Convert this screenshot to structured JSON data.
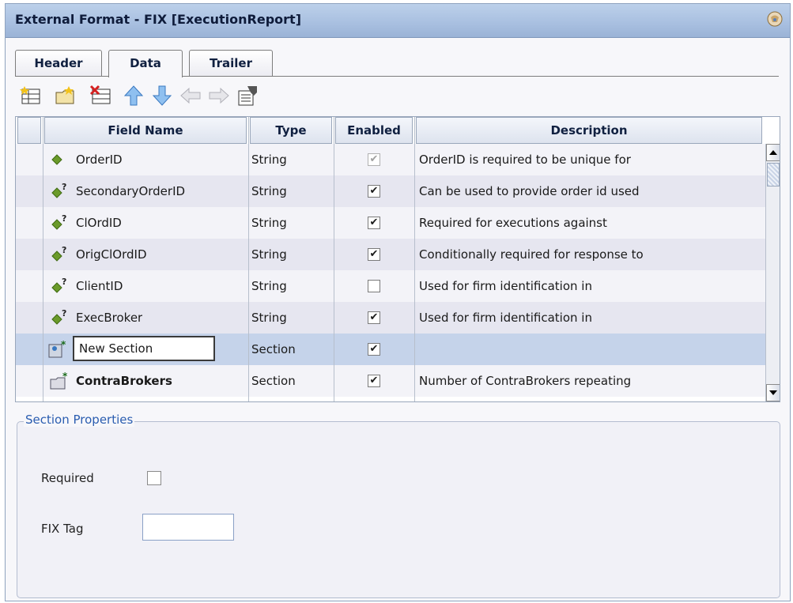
{
  "window": {
    "title": "External Format - FIX [ExecutionReport]"
  },
  "tabs": [
    {
      "label": "Header"
    },
    {
      "label": "Data",
      "active": true
    },
    {
      "label": "Trailer"
    }
  ],
  "toolbar": {
    "buttons": [
      "add-field-icon",
      "add-section-icon",
      "delete-icon",
      "move-up-icon",
      "move-down-icon",
      "move-left-icon",
      "move-right-icon",
      "properties-icon"
    ]
  },
  "grid": {
    "columns": [
      "Field Name",
      "Type",
      "Enabled",
      "Description"
    ],
    "rows": [
      {
        "name": "OrderID",
        "type": "String",
        "enabled": true,
        "enabled_disabled": true,
        "description": "OrderID is required to be unique for",
        "icon": "required-field-icon"
      },
      {
        "name": "SecondaryOrderID",
        "type": "String",
        "enabled": true,
        "description": "Can be used to provide order id used",
        "icon": "optional-field-icon"
      },
      {
        "name": "ClOrdID",
        "type": "String",
        "enabled": true,
        "description": "Required for executions against",
        "icon": "optional-field-icon"
      },
      {
        "name": "OrigClOrdID",
        "type": "String",
        "enabled": true,
        "description": "Conditionally required for response to",
        "icon": "optional-field-icon"
      },
      {
        "name": "ClientID",
        "type": "String",
        "enabled": false,
        "description": "Used for firm identification in",
        "icon": "optional-field-icon"
      },
      {
        "name": "ExecBroker",
        "type": "String",
        "enabled": true,
        "description": "Used for firm identification in",
        "icon": "optional-field-icon"
      },
      {
        "name": "New Section",
        "type": "Section",
        "enabled": true,
        "description": "",
        "icon": "new-section-icon",
        "editing": true,
        "selected": true
      },
      {
        "name": "ContraBrokers",
        "type": "Section",
        "enabled": true,
        "description": "Number of ContraBrokers repeating",
        "icon": "section-folder-icon",
        "bold": true
      }
    ]
  },
  "section_properties": {
    "legend": "Section Properties",
    "required_label": "Required",
    "required_checked": false,
    "fix_tag_label": "FIX Tag",
    "fix_tag_value": ""
  },
  "colors": {
    "title_bar": "#a8bfe0",
    "selected_row": "#c5d3ea",
    "legend_text": "#2a5db0"
  }
}
